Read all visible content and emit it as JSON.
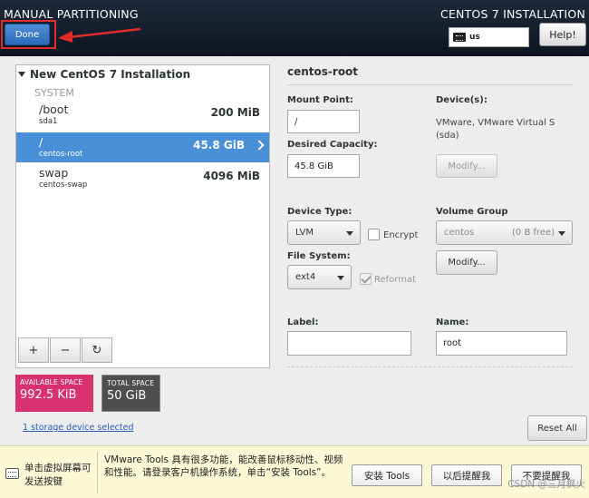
{
  "header": {
    "title": "MANUAL PARTITIONING",
    "product": "CENTOS 7 INSTALLATION",
    "done_label": "Done",
    "keyboard_layout": "us",
    "help_label": "Help!"
  },
  "tree": {
    "root_label": "New CentOS 7 Installation",
    "group_label": "SYSTEM",
    "partitions": [
      {
        "name": "/boot",
        "device": "sda1",
        "size": "200 MiB",
        "selected": false
      },
      {
        "name": "/",
        "device": "centos-root",
        "size": "45.8 GiB",
        "selected": true
      },
      {
        "name": "swap",
        "device": "centos-swap",
        "size": "4096 MiB",
        "selected": false
      }
    ],
    "toolbar": {
      "add": "+",
      "remove": "−",
      "refresh": "↻"
    }
  },
  "space": {
    "available_label": "AVAILABLE SPACE",
    "available_value": "992.5 KiB",
    "total_label": "TOTAL SPACE",
    "total_value": "50 GiB",
    "available_color": "#d8326e",
    "total_color": "#4e4e4e"
  },
  "storage_link": "1 storage device selected",
  "details": {
    "title": "centos-root",
    "mount_point_label": "Mount Point:",
    "mount_point_value": "/",
    "capacity_label": "Desired Capacity:",
    "capacity_value": "45.8 GiB",
    "devices_label": "Device(s):",
    "devices_value_line1": "VMware, VMware Virtual S",
    "devices_value_line2": "(sda)",
    "modify_label": "Modify...",
    "device_type_label": "Device Type:",
    "device_type_value": "LVM",
    "encrypt_label": "Encrypt",
    "volume_group_label": "Volume Group",
    "volume_group_value": "centos",
    "volume_group_free": "(0 B free)",
    "vg_modify_label": "Modify...",
    "file_system_label": "File System:",
    "file_system_value": "ext4",
    "reformat_label": "Reformat",
    "label_label": "Label:",
    "label_value": "",
    "name_label": "Name:",
    "name_value": "root"
  },
  "reset_label": "Reset All",
  "vmware_bar": {
    "hint": "单击虚拟屏幕可发送按键",
    "message": "VMware Tools 具有很多功能，能改善鼠标移动性、视频和性能。请登录客户机操作系统，单击“安装 Tools”。",
    "install_label": "安装 Tools",
    "later_label": "以后提醒我",
    "never_label": "不要提醒我"
  },
  "watermark": "CSDN @三月枫火"
}
